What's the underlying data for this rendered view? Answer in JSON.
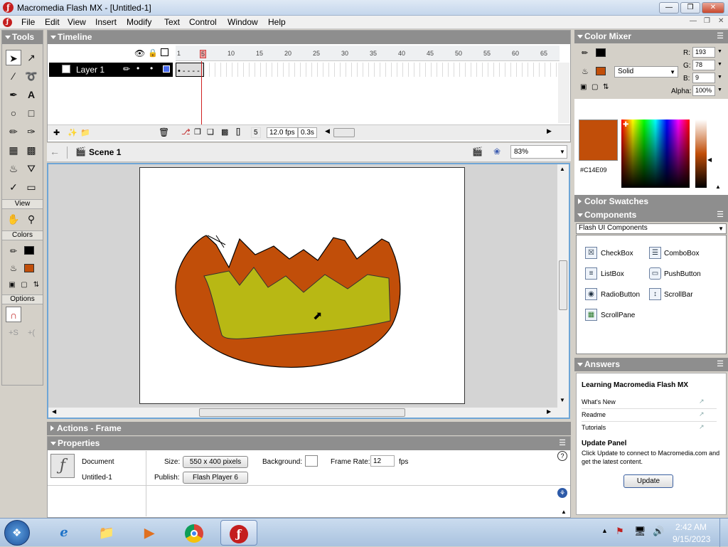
{
  "window": {
    "title": "Macromedia Flash MX - [Untitled-1]"
  },
  "menu": [
    "File",
    "Edit",
    "View",
    "Insert",
    "Modify",
    "Text",
    "Control",
    "Window",
    "Help"
  ],
  "tools_panel": {
    "title": "Tools",
    "view_label": "View",
    "colors_label": "Colors",
    "options_label": "Options"
  },
  "timeline": {
    "title": "Timeline",
    "layer_name": "Layer 1",
    "ruler_numbers": [
      "1",
      "5",
      "10",
      "15",
      "20",
      "25",
      "30",
      "35",
      "40",
      "45",
      "50",
      "55",
      "60",
      "65"
    ],
    "current_frame": "5",
    "fps": "12.0 fps",
    "elapsed": "0.3s"
  },
  "editbar": {
    "scene": "Scene 1",
    "zoom": "83%"
  },
  "actions_panel": {
    "title": "Actions - Frame"
  },
  "properties": {
    "title": "Properties",
    "doc_type": "Document",
    "doc_name": "Untitled-1",
    "size_label": "Size:",
    "size_value": "550 x 400 pixels",
    "background_label": "Background:",
    "frame_rate_label": "Frame Rate:",
    "frame_rate_value": "12",
    "fps_unit": "fps",
    "publish_label": "Publish:",
    "publish_value": "Flash Player 6"
  },
  "color_mixer": {
    "title": "Color Mixer",
    "r_label": "R:",
    "r_value": "193",
    "g_label": "G:",
    "g_value": "78",
    "b_label": "B:",
    "b_value": "9",
    "alpha_label": "Alpha:",
    "alpha_value": "100%",
    "fill_type": "Solid",
    "hex": "#C14E09",
    "fill_color": "#C14E09"
  },
  "color_swatches": {
    "title": "Color Swatches"
  },
  "components": {
    "title": "Components",
    "set": "Flash UI Components",
    "items": [
      "CheckBox",
      "ComboBox",
      "ListBox",
      "PushButton",
      "RadioButton",
      "ScrollBar",
      "ScrollPane"
    ]
  },
  "answers": {
    "title": "Answers",
    "heading": "Learning Macromedia Flash MX",
    "links": [
      "What's New",
      "Readme",
      "Tutorials"
    ],
    "update_heading": "Update Panel",
    "update_text": "Click Update to connect to Macromedia.com and get the latest content.",
    "update_button": "Update"
  },
  "taskbar": {
    "time": "2:42 AM",
    "date": "9/15/2023"
  },
  "shape_colors": {
    "outer": "#C14E09",
    "inner": "#B8B814"
  }
}
